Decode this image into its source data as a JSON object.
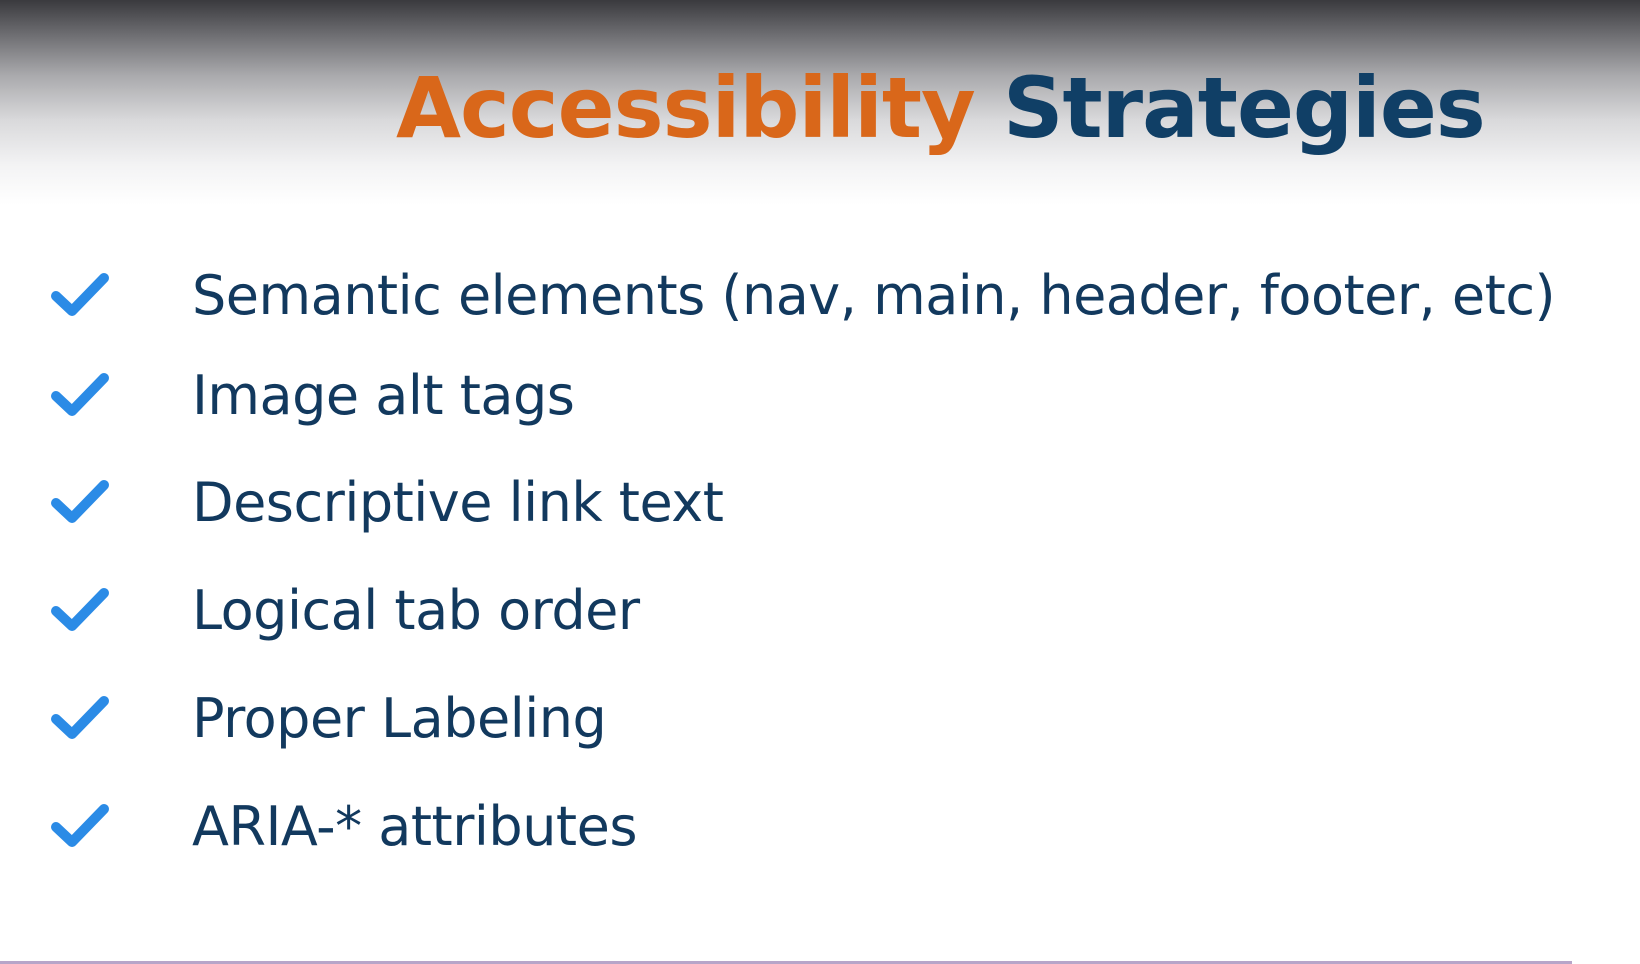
{
  "slide": {
    "title": {
      "highlight": "Accessibility",
      "rest": "Strategies"
    },
    "items": [
      {
        "text": "Semantic elements (nav, main, header, footer, etc)",
        "icon": "checkmark-icon"
      },
      {
        "text": "Image alt tags",
        "icon": "checkmark-icon"
      },
      {
        "text": "Descriptive link text",
        "icon": "checkmark-icon"
      },
      {
        "text": "Logical tab order",
        "icon": "checkmark-icon"
      },
      {
        "text": "Proper Labeling",
        "icon": "checkmark-icon"
      },
      {
        "text": "ARIA-* attributes",
        "icon": "checkmark-icon"
      }
    ]
  },
  "colors": {
    "title_highlight": "#d9671a",
    "title_rest": "#103f66",
    "item_text": "#12395e",
    "checkmark": "#2b8be6"
  }
}
